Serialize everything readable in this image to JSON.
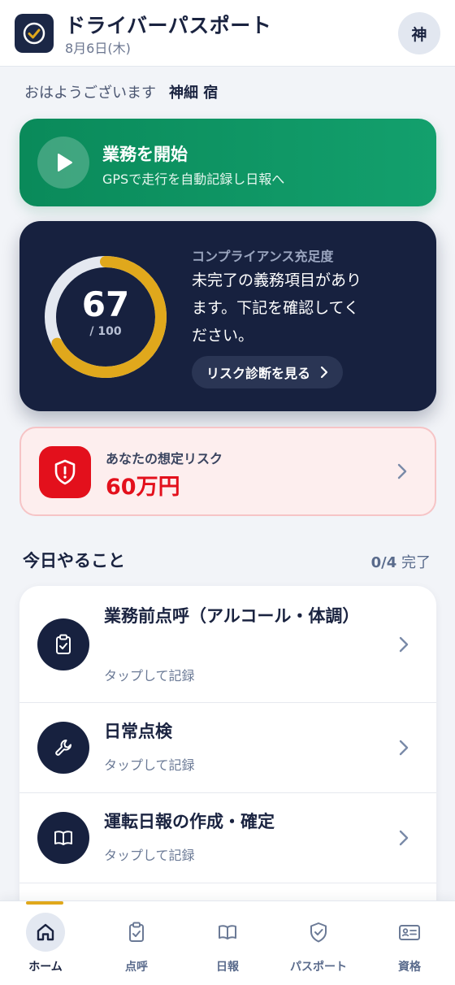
{
  "header": {
    "title": "ドライバーパスポート",
    "date": "8月6日(木)",
    "avatar_initial": "神"
  },
  "greeting": {
    "text": "おはようございます",
    "name": "神細 宿"
  },
  "start_card": {
    "title": "業務を開始",
    "subtitle": "GPSで走行を自動記録し日報へ",
    "color": "#0e955f"
  },
  "compliance": {
    "label": "コンプライアンス充足度",
    "score": "67",
    "max": "/ 100",
    "progress": 0.67,
    "message": "未完了の義務項目があります。下記を確認してください。",
    "button_label": "リスク診断を見る",
    "ring_color": "#e0a81c",
    "track_color": "#e4e8f0"
  },
  "risk": {
    "label": "あなたの想定リスク",
    "value": "60万円",
    "color": "#e3101c"
  },
  "today": {
    "title": "今日やること",
    "done": "0/4",
    "done_suffix": "完了",
    "tasks": [
      {
        "title": "業務前点呼（アルコール・体調）",
        "sub": "タップして記録",
        "icon": "clipboard-check-icon"
      },
      {
        "title": "日常点検",
        "sub": "タップして記録",
        "icon": "wrench-icon"
      },
      {
        "title": "運転日報の作成・確定",
        "sub": "タップして記録",
        "icon": "book-icon"
      }
    ]
  },
  "nav": {
    "items": [
      {
        "label": "ホーム",
        "icon": "home-icon",
        "active": true
      },
      {
        "label": "点呼",
        "icon": "clipboard-check-icon"
      },
      {
        "label": "日報",
        "icon": "book-icon"
      },
      {
        "label": "パスポート",
        "icon": "shield-check-icon"
      },
      {
        "label": "資格",
        "icon": "id-card-icon"
      }
    ]
  }
}
